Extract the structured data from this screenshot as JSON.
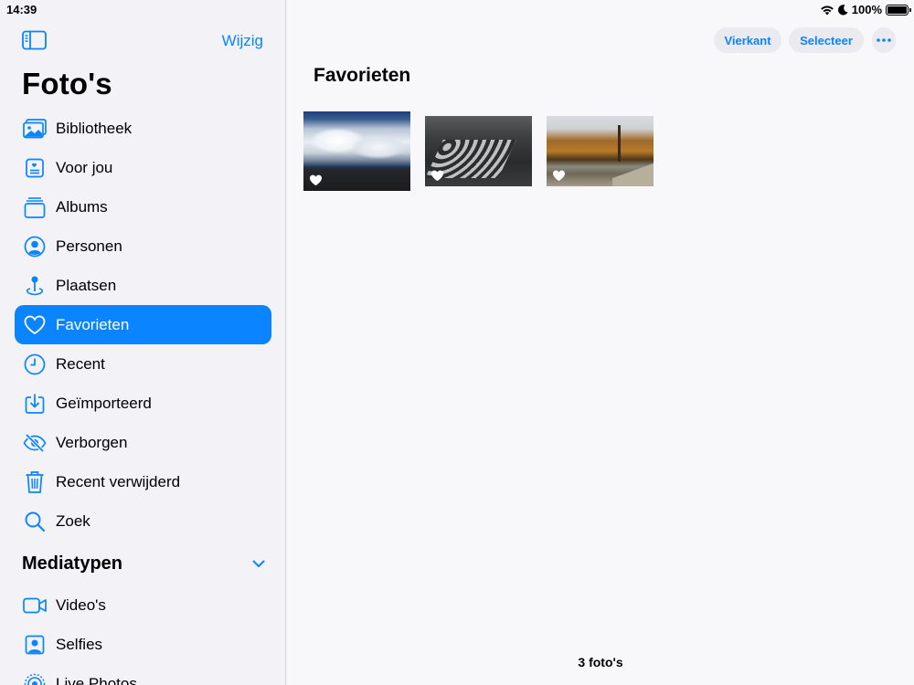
{
  "status": {
    "time": "14:39",
    "battery": "100%"
  },
  "sidebar": {
    "edit_label": "Wijzig",
    "title": "Foto's",
    "items": [
      {
        "label": "Bibliotheek",
        "icon": "library-icon"
      },
      {
        "label": "Voor jou",
        "icon": "for-you-icon"
      },
      {
        "label": "Albums",
        "icon": "albums-icon"
      },
      {
        "label": "Personen",
        "icon": "person-icon"
      },
      {
        "label": "Plaatsen",
        "icon": "map-pin-icon"
      },
      {
        "label": "Favorieten",
        "icon": "heart-icon",
        "selected": true
      },
      {
        "label": "Recent",
        "icon": "clock-icon"
      },
      {
        "label": "Geïmporteerd",
        "icon": "import-icon"
      },
      {
        "label": "Verborgen",
        "icon": "eye-slash-icon"
      },
      {
        "label": "Recent verwijderd",
        "icon": "trash-icon"
      },
      {
        "label": "Zoek",
        "icon": "search-icon"
      }
    ],
    "media_section": {
      "title": "Mediatypen",
      "items": [
        {
          "label": "Video's",
          "icon": "video-icon"
        },
        {
          "label": "Selfies",
          "icon": "selfie-icon"
        },
        {
          "label": "Live Photos",
          "icon": "live-photo-icon"
        }
      ]
    }
  },
  "main": {
    "square_label": "Vierkant",
    "select_label": "Selecteer",
    "title": "Favorieten",
    "photos": [
      {
        "subject": "sky with clouds",
        "favorite": true
      },
      {
        "subject": "typewriter keys",
        "favorite": true
      },
      {
        "subject": "autumn lake path",
        "favorite": true
      }
    ],
    "count": "3 foto's"
  },
  "colors": {
    "accent": "#0a84ff",
    "sidebar_bg": "#f2f2f7",
    "main_bg": "#f8f8fb"
  }
}
